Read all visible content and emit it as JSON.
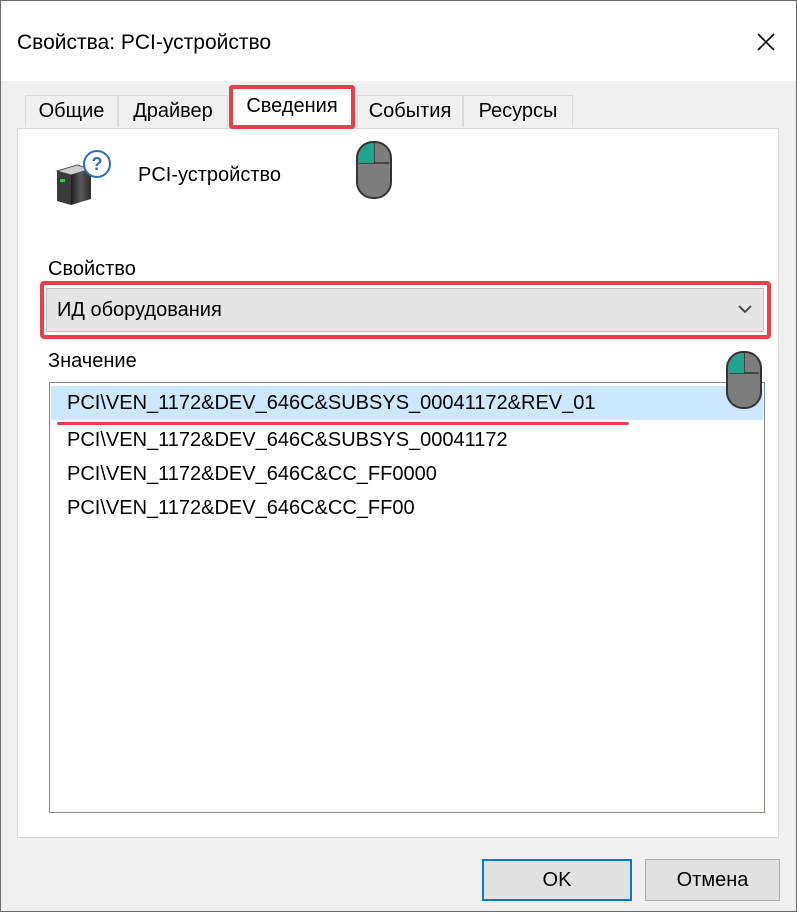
{
  "window": {
    "title": "Свойства: PCI-устройство"
  },
  "tabs": [
    {
      "label": "Общие"
    },
    {
      "label": "Драйвер"
    },
    {
      "label": "Сведения"
    },
    {
      "label": "События"
    },
    {
      "label": "Ресурсы"
    }
  ],
  "active_tab": "Сведения",
  "device": {
    "name": "PCI-устройство",
    "icon": "unknown-device-icon"
  },
  "property": {
    "label": "Свойство",
    "selected": "ИД оборудования"
  },
  "value": {
    "label": "Значение",
    "items": [
      "PCI\\VEN_1172&DEV_646C&SUBSYS_00041172&REV_01",
      "PCI\\VEN_1172&DEV_646C&SUBSYS_00041172",
      "PCI\\VEN_1172&DEV_646C&CC_FF0000",
      "PCI\\VEN_1172&DEV_646C&CC_FF00"
    ],
    "selected_index": 0
  },
  "buttons": {
    "ok": "OK",
    "cancel": "Отмена"
  },
  "colors": {
    "highlight_red": "#e8404a",
    "selection_blue": "#cce8ff",
    "mouse_button_teal": "#1fa58c"
  }
}
